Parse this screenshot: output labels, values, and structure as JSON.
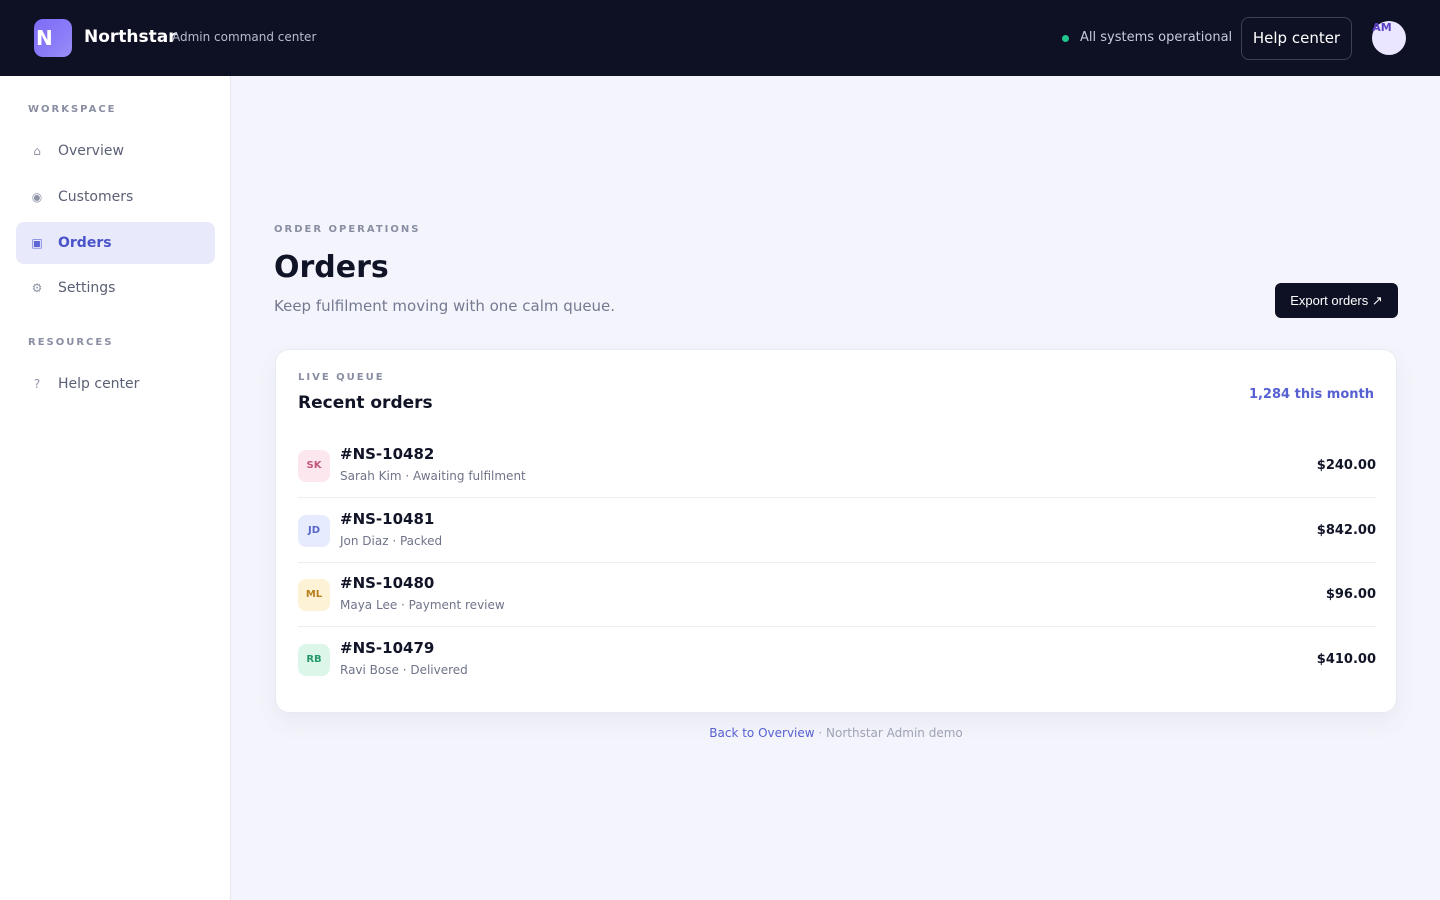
{
  "header": {
    "logo_letter": "N",
    "brand": "Northstar",
    "brand_subtitle": "Admin command center",
    "status_text": "All systems operational",
    "help_button": "Help center",
    "avatar_initials": "AM",
    "status_color": "#22c58b"
  },
  "sidebar": {
    "workspace_label": "WORKSPACE",
    "resources_label": "RESOURCES",
    "items": [
      {
        "label": "Overview",
        "icon": "⌂",
        "icon_name": "home-icon"
      },
      {
        "label": "Customers",
        "icon": "◉",
        "icon_name": "customers-icon"
      },
      {
        "label": "Orders",
        "icon": "▣",
        "icon_name": "orders-icon",
        "active": true
      },
      {
        "label": "Settings",
        "icon": "⚙",
        "icon_name": "gear-icon"
      }
    ],
    "resources": [
      {
        "label": "Help center",
        "icon": "?",
        "icon_name": "help-icon"
      }
    ]
  },
  "main": {
    "eyebrow": "ORDER OPERATIONS",
    "title": "Orders",
    "subtitle": "Keep fulfilment moving with one calm queue.",
    "export_button": "Export orders ↗"
  },
  "card": {
    "eyebrow": "LIVE QUEUE",
    "title": "Recent orders",
    "count": "1,284 this month",
    "orders": [
      {
        "initials": "SK",
        "id": "#NS-10482",
        "meta": "Sarah Kim · Awaiting fulfilment",
        "amount": "$240.00",
        "badge_bg": "#fde7ee",
        "badge_fg": "#c0577a"
      },
      {
        "initials": "JD",
        "id": "#NS-10481",
        "meta": "Jon Diaz · Packed",
        "amount": "$842.00",
        "badge_bg": "#e6ecfd",
        "badge_fg": "#5866c9"
      },
      {
        "initials": "ML",
        "id": "#NS-10480",
        "meta": "Maya Lee · Payment review",
        "amount": "$96.00",
        "badge_bg": "#fdf1d6",
        "badge_fg": "#b8801c"
      },
      {
        "initials": "RB",
        "id": "#NS-10479",
        "meta": "Ravi Bose · Delivered",
        "amount": "$410.00",
        "badge_bg": "#dcf6ea",
        "badge_fg": "#279a69"
      }
    ]
  },
  "footer": {
    "link": "Back to Overview",
    "text": " · Northstar Admin demo"
  }
}
